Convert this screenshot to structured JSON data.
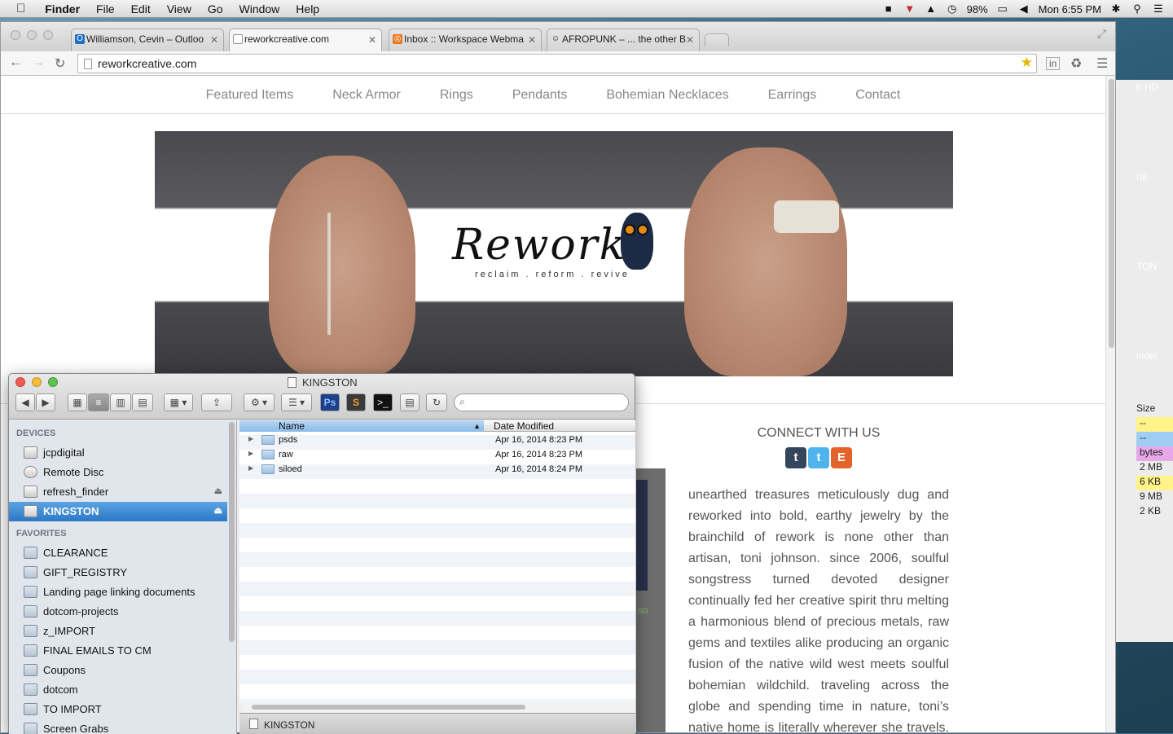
{
  "menubar": {
    "apple": "",
    "app": "Finder",
    "items": [
      "File",
      "Edit",
      "View",
      "Go",
      "Window",
      "Help"
    ],
    "battery": "98%",
    "clock": "Mon 6:55 PM"
  },
  "browser": {
    "tabs": [
      {
        "label": "Williamson, Cevin – Outloo"
      },
      {
        "label": "reworkcreative.com"
      },
      {
        "label": "Inbox :: Workspace Webma"
      },
      {
        "label": "AFROPUNK – ... the other B"
      }
    ],
    "url": "reworkcreative.com"
  },
  "site": {
    "nav": [
      "Featured Items",
      "Neck Armor",
      "Rings",
      "Pendants",
      "Bohemian Necklaces",
      "Earrings",
      "Contact"
    ],
    "logo_word": "Rework",
    "logo_tag": "reclaim . reform . revive",
    "connect": "CONNECT WITH US",
    "social": [
      "t",
      "t",
      "E"
    ],
    "about": "unearthed treasures meticulously dug and reworked into bold, earthy jewelry by the brainchild of rework is none other than artisan, toni johnson. since 2006, soulful songstress turned devoted designer continually fed her creative spirit thru melting a harmonious blend of precious metals, raw gems and textiles alike producing an organic fusion of the native wild west meets soulful bohemian wildchild. traveling across the globe and spending time in nature, toni’s native home is literally wherever she travels. no boundaries and no"
  },
  "bgfinder": {
    "labels": [
      "h HD",
      "tal",
      "TON",
      "inder"
    ],
    "size_header": "Size",
    "sizes": [
      "--",
      "--",
      "bytes",
      "2 MB",
      "6 KB",
      "9 MB",
      "2 KB"
    ]
  },
  "finder": {
    "title": "KINGSTON",
    "devices_header": "DEVICES",
    "devices": [
      {
        "label": "jcpdigital"
      },
      {
        "label": "Remote Disc"
      },
      {
        "label": "refresh_finder"
      },
      {
        "label": "KINGSTON"
      }
    ],
    "favorites_header": "FAVORITES",
    "favorites": [
      "CLEARANCE",
      "GIFT_REGISTRY",
      "Landing page linking documents",
      "dotcom-projects",
      "z_IMPORT",
      "FINAL EMAILS TO CM",
      "Coupons",
      "dotcom",
      "TO IMPORT",
      "Screen Grabs"
    ],
    "columns": {
      "name": "Name",
      "date": "Date Modified"
    },
    "files": [
      {
        "name": "psds",
        "date": "Apr 16, 2014 8:23 PM"
      },
      {
        "name": "raw",
        "date": "Apr 16, 2014 8:23 PM"
      },
      {
        "name": "siloed",
        "date": "Apr 16, 2014 8:24 PM"
      }
    ],
    "status": "KINGSTON"
  }
}
